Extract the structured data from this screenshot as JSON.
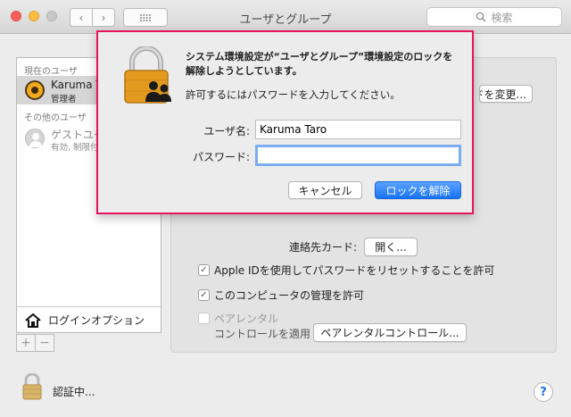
{
  "window": {
    "title": "ユーザとグループ",
    "search_placeholder": "検索",
    "back_glyph": "‹",
    "forward_glyph": "›"
  },
  "sidebar": {
    "current_users_header": "現在のユーザ",
    "other_users_header": "その他のユーザ",
    "users": [
      {
        "name": "Karuma Taro",
        "role": "管理者",
        "icon": "sunflower-avatar"
      },
      {
        "name": "ゲストユーザ",
        "role": "有効, 制限付き",
        "icon": "guest-avatar"
      }
    ],
    "login_options_label": "ログインオプション",
    "add_label": "+",
    "remove_label": "−"
  },
  "panel": {
    "change_password_label": "ドを変更...",
    "contact_card_label": "連絡先カード:",
    "open_button_label": "開く...",
    "checkboxes": [
      {
        "label": "Apple IDを使用してパスワードをリセットすることを許可",
        "checked": true
      },
      {
        "label": "このコンピュータの管理を許可",
        "checked": true
      },
      {
        "label": "ペアレンタル",
        "checked": false
      }
    ],
    "parental_sub_label": "コントロールを適用",
    "parental_button_label": "ペアレンタルコントロール..."
  },
  "bottom": {
    "auth_label": "認証中...",
    "help_label": "?"
  },
  "dialog": {
    "message": "システム環境設定が“ユーザとグループ”環境設定のロックを解除しようとしています。",
    "instruction": "許可するにはパスワードを入力してください。",
    "username_label": "ユーザ名:",
    "username_value": "Karuma Taro",
    "password_label": "パスワード:",
    "password_value": "",
    "cancel_label": "キャンセル",
    "unlock_label": "ロックを解除"
  },
  "colors": {
    "highlight_border": "#e5145f",
    "primary_button": "#1673f5",
    "focus_ring": "#7aaef0"
  }
}
